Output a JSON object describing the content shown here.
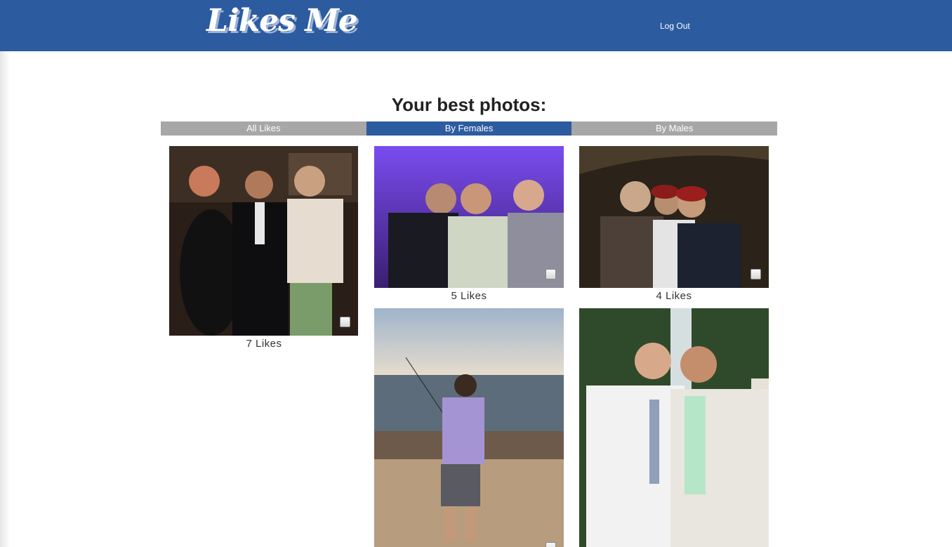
{
  "header": {
    "logo": "Likes Me",
    "logout_label": "Log Out"
  },
  "main": {
    "title": "Your best photos:",
    "tabs": [
      {
        "label": "All Likes",
        "active": false
      },
      {
        "label": "By Females",
        "active": true
      },
      {
        "label": "By Males",
        "active": false
      }
    ],
    "photos": [
      {
        "likes_label": "7 Likes",
        "scene": "group-party-photo"
      },
      {
        "likes_label": "5 Likes",
        "scene": "purple-tent-party-photo"
      },
      {
        "likes_label": "4 Likes",
        "scene": "helmets-night-photo"
      },
      {
        "likes_label": "",
        "scene": "beach-fishing-photo"
      },
      {
        "likes_label": "",
        "scene": "fountain-suits-photo"
      }
    ]
  },
  "colors": {
    "brand": "#2c5ba0",
    "tab_inactive": "#a7a7a7"
  }
}
